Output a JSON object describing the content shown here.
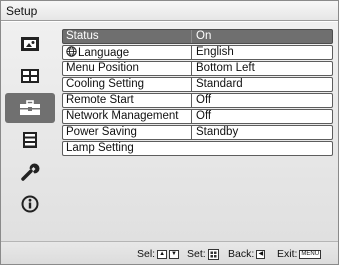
{
  "window": {
    "title": "Setup"
  },
  "sidebar": {
    "items": [
      {
        "icon": "picture-icon",
        "selected": false
      },
      {
        "icon": "screen-icon",
        "selected": false
      },
      {
        "icon": "toolbox-icon",
        "selected": true
      },
      {
        "icon": "menu-list-icon",
        "selected": false
      },
      {
        "icon": "wrench-icon",
        "selected": false
      },
      {
        "icon": "info-icon",
        "selected": false
      }
    ]
  },
  "settings": [
    {
      "label": "Status",
      "value": "On",
      "selected": true
    },
    {
      "label": "Language",
      "value": "English",
      "icon": "globe-icon"
    },
    {
      "label": "Menu Position",
      "value": "Bottom Left"
    },
    {
      "label": "Cooling Setting",
      "value": "Standard"
    },
    {
      "label": "Remote Start",
      "value": "Off"
    },
    {
      "label": "Network Management",
      "value": "Off"
    },
    {
      "label": "Power Saving",
      "value": "Standby"
    },
    {
      "label": "Lamp Setting",
      "value": ""
    }
  ],
  "footer": {
    "sel_label": "Sel:",
    "set_label": "Set:",
    "back_label": "Back:",
    "exit_label": "Exit:",
    "exit_key": "MENU"
  }
}
